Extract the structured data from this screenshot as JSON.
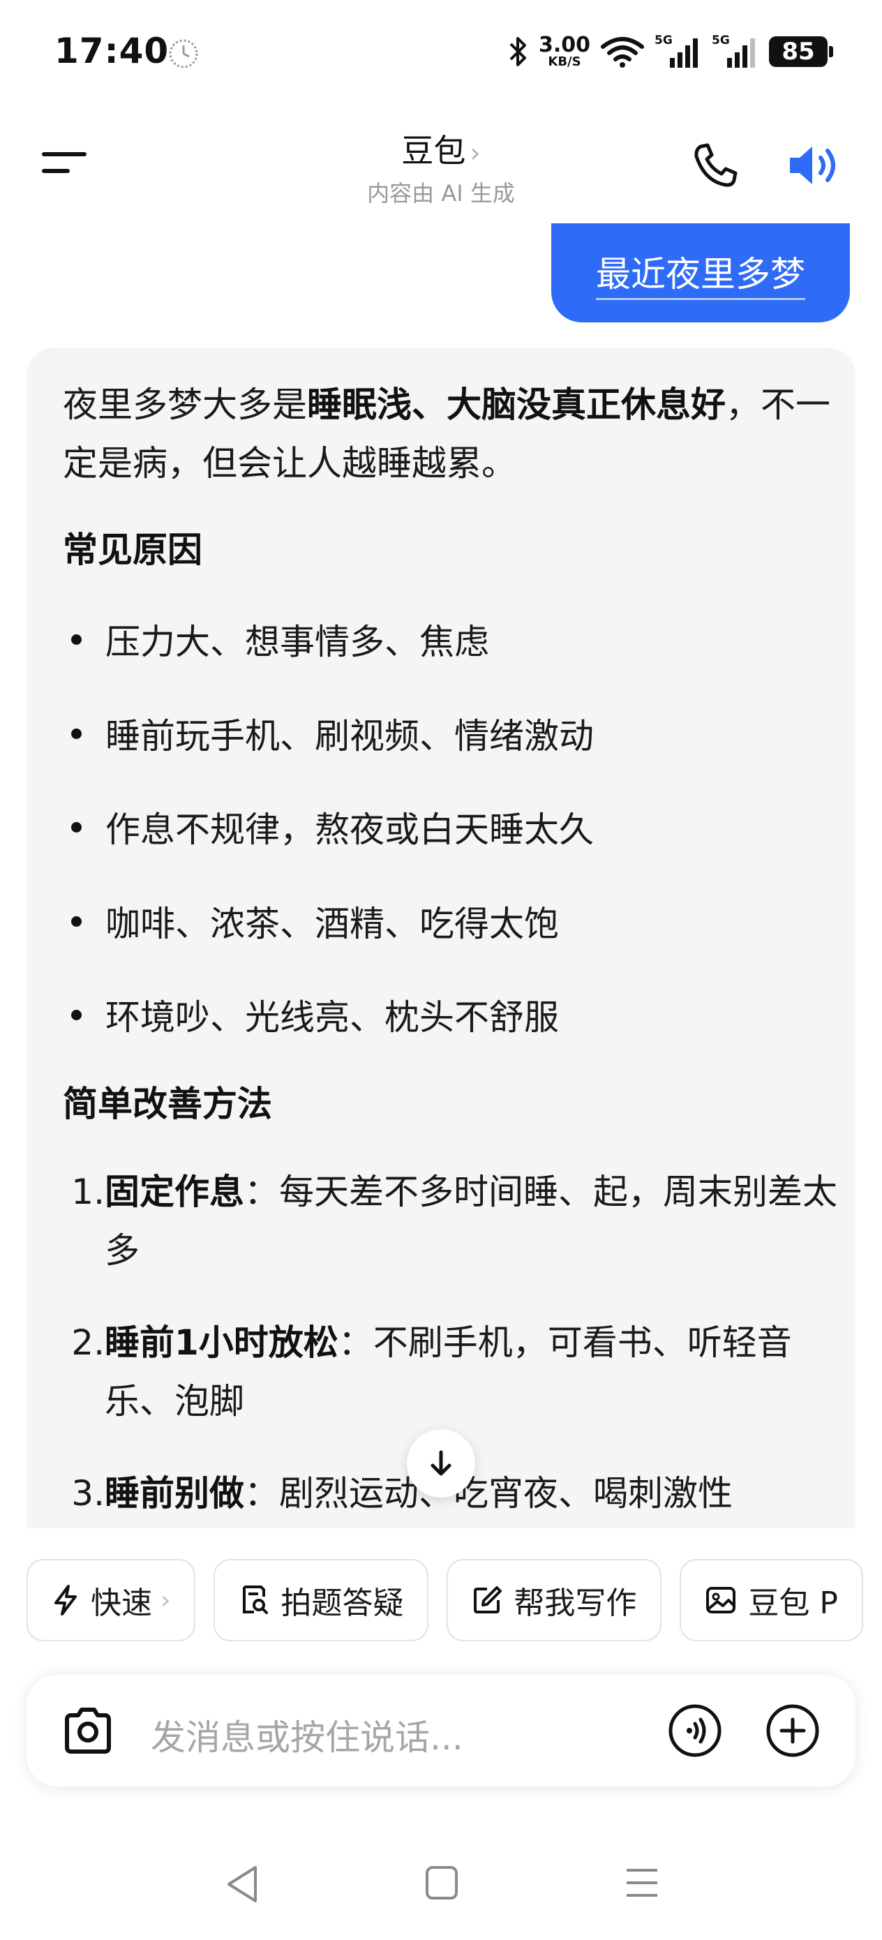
{
  "status_bar": {
    "time": "17:40",
    "net_speed_value": "3.00",
    "net_speed_unit": "KB/S",
    "signal_1_label": "5G",
    "signal_2_label": "5G",
    "battery": "85",
    "icons": [
      "clock-icon",
      "bluetooth-icon",
      "wifi-icon",
      "signal-icon",
      "signal-icon",
      "battery-icon"
    ]
  },
  "header": {
    "title": "豆包",
    "chevron": "›",
    "subtitle": "内容由 AI 生成",
    "accent_color": "#2e6bf6"
  },
  "user_message": {
    "text": "最近夜里多梦"
  },
  "answer": {
    "intro_plain_1": "夜里多梦大多是",
    "intro_bold": "睡眠浅、大脑没真正休息好",
    "intro_plain_2": "，不一定是病，但会让人越睡越累。",
    "section1_title": "常见原因",
    "reasons": [
      "压力大、想事情多、焦虑",
      "睡前玩手机、刷视频、情绪激动",
      "作息不规律，熬夜或白天睡太久",
      "咖啡、浓茶、酒精、吃得太饱",
      "环境吵、光线亮、枕头不舒服"
    ],
    "section2_title": "简单改善方法",
    "methods": [
      {
        "num": "1.",
        "bold": "固定作息",
        "text": "：每天差不多时间睡、起，周末别差太多"
      },
      {
        "num": "2.",
        "bold": "睡前1小时放松",
        "text": "：不刷手机，可看书、听轻音乐、泡脚"
      },
      {
        "num": "3.",
        "bold": "睡前别做",
        "text": "：剧烈运动、吃宵夜、喝刺激性"
      }
    ]
  },
  "quick_actions": {
    "fast": "快速",
    "fast_chevron": "›",
    "photo_qa": "拍题答疑",
    "write": "帮我写作",
    "doubao_p": "豆包 P"
  },
  "input": {
    "placeholder": "发消息或按住说话..."
  }
}
